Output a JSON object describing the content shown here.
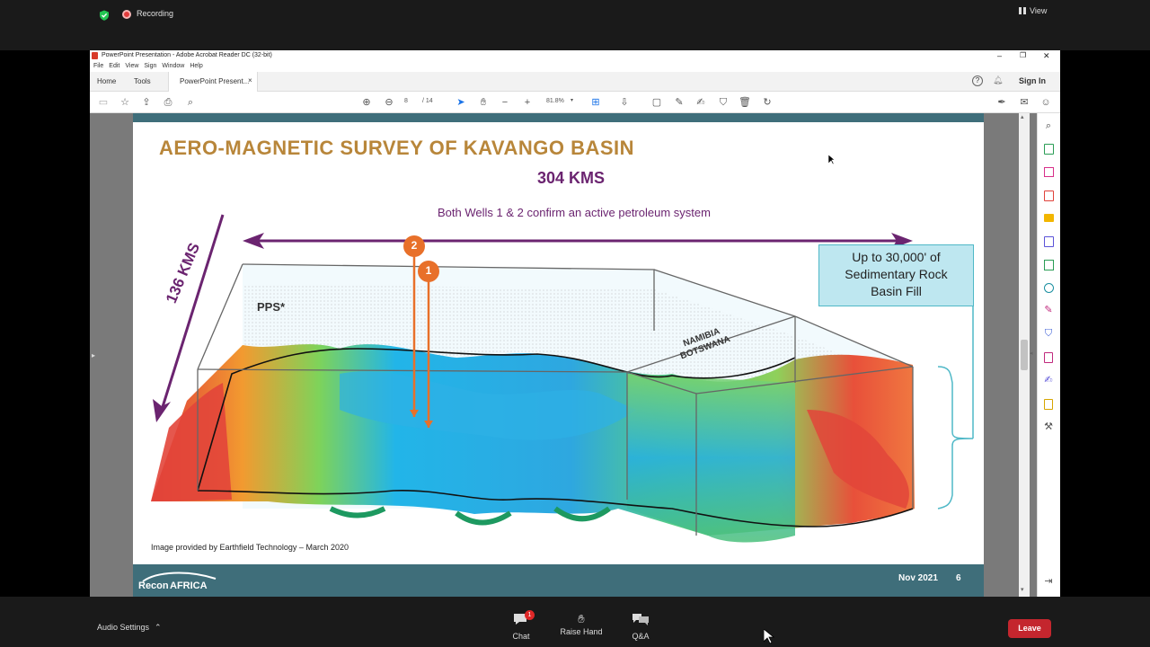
{
  "zoom_meeting": {
    "recording_label": "Recording",
    "view_label": "View",
    "audio_settings_label": "Audio Settings",
    "chat_label": "Chat",
    "chat_badge": "1",
    "raise_hand_label": "Raise Hand",
    "qa_label": "Q&A",
    "leave_label": "Leave"
  },
  "acrobat": {
    "window_title": "PowerPoint Presentation - Adobe Acrobat Reader DC (32-bit)",
    "menu": [
      "File",
      "Edit",
      "View",
      "Sign",
      "Window",
      "Help"
    ],
    "home_tab": "Home",
    "tools_tab": "Tools",
    "doc_tab": "PowerPoint Present...",
    "sign_in": "Sign In",
    "page_current": "8",
    "page_total": "/ 14",
    "zoom": "81.8%"
  },
  "slide": {
    "title": "AERO-MAGNETIC SURVEY OF KAVANGO BASIN",
    "width_label": "304 KMS",
    "depth_label": "136 KMS",
    "subtitle": "Both Wells 1 & 2 confirm an active petroleum system",
    "well_1": "1",
    "well_2": "2",
    "pps_label": "PPS*",
    "namibia": "NAMIBIA",
    "botswana": "BOTSWANA",
    "callout_line1": "Up to 30,000' of",
    "callout_line2": "Sedimentary Rock",
    "callout_line3": "Basin Fill",
    "credit": "Image provided by Earthfield Technology – March 2020",
    "date": "Nov 2021",
    "slide_number": "6",
    "logo_recon": "Recon",
    "logo_africa": "AFRICA"
  },
  "colors": {
    "title": "#B8863A",
    "arrow": "#6B2470",
    "footer_bar": "#3F6E7A",
    "callout_bg": "#BEE7F0",
    "callout_border": "#4FB8C7",
    "well_orange": "#E8702A",
    "leave_red": "#C4262E"
  }
}
